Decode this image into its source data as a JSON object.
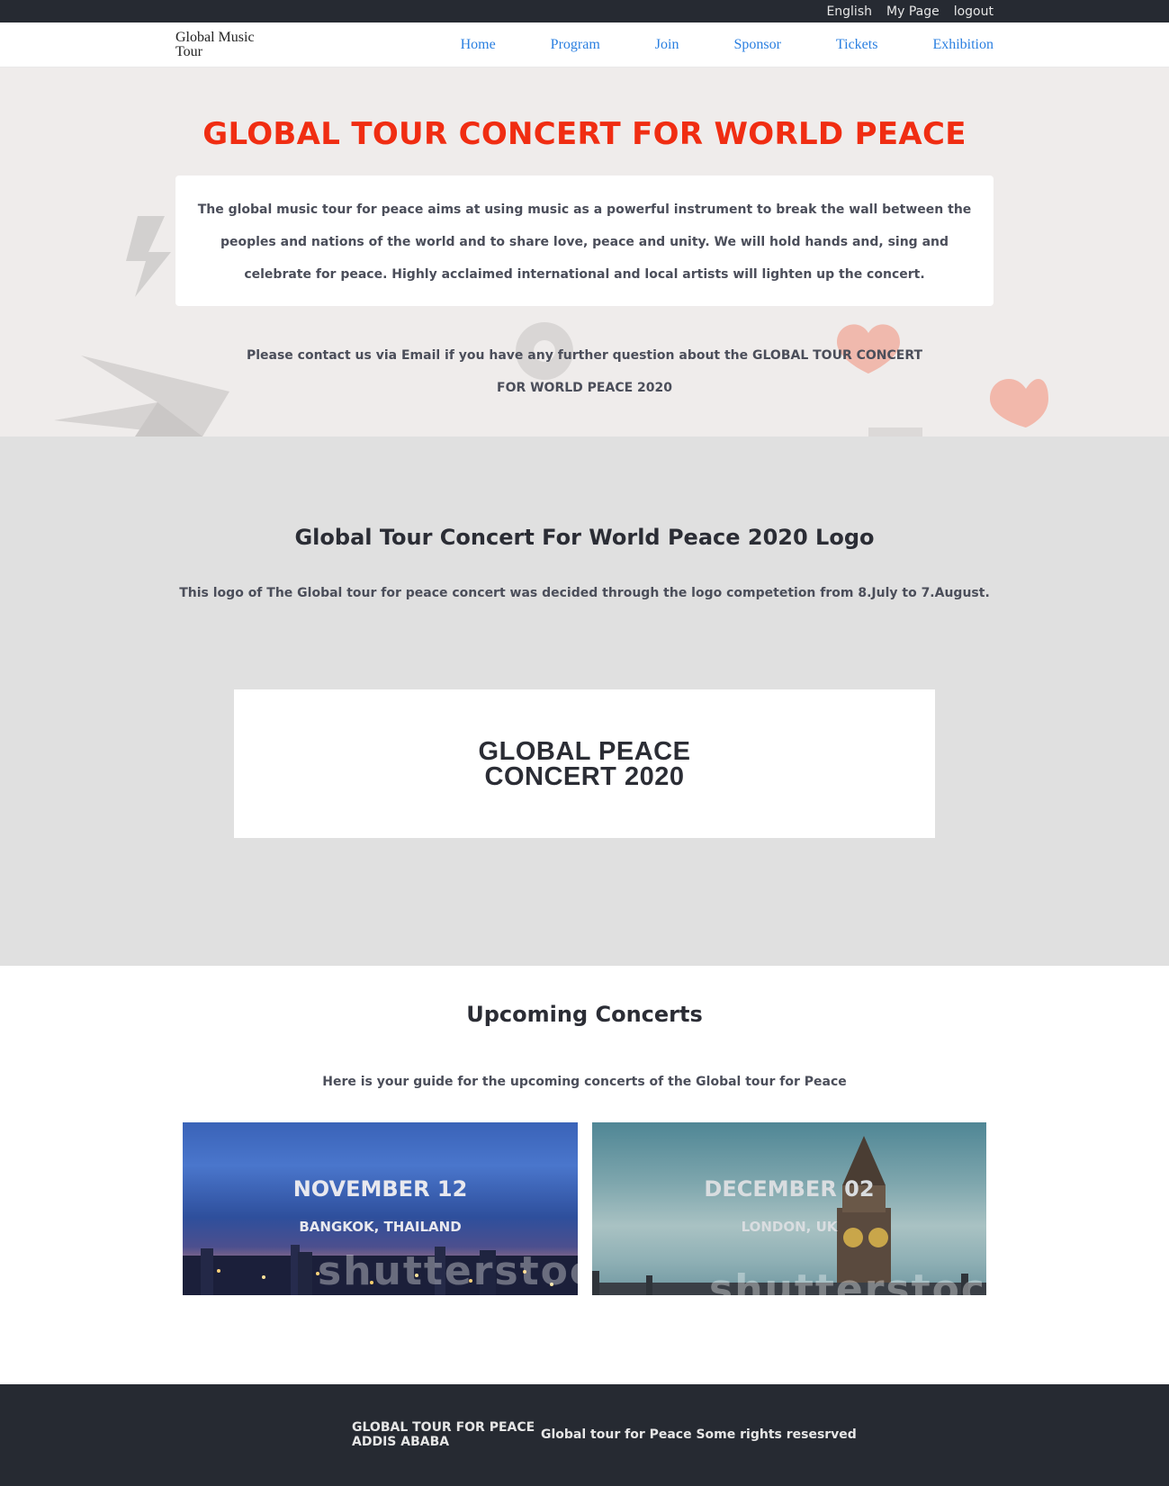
{
  "utility_bar": {
    "language": "English",
    "my_page": "My Page",
    "logout": "logout"
  },
  "navbar": {
    "brand_line1": "Global Music",
    "brand_line2": "Tour",
    "links": [
      "Home",
      "Program",
      "Join",
      "Sponsor",
      "Tickets",
      "Exhibition"
    ]
  },
  "hero": {
    "title": "GLOBAL TOUR CONCERT FOR WORLD PEACE",
    "intro": "The global music tour for peace aims at using music as a powerful instrument to break the wall between the peoples and nations of the world and to share love, peace and unity. We will hold hands and, sing and celebrate for peace. Highly acclaimed international and local artists will lighten up the concert.",
    "contact": "Please contact us via Email if you have any further question about the GLOBAL TOUR CONCERT FOR WORLD PEACE 2020"
  },
  "logo_section": {
    "heading": "Global Tour Concert For World Peace 2020 Logo",
    "description": "This logo of The Global tour for peace concert was decided through the logo competetion from 8.July to 7.August.",
    "logo_line1": "GLOBAL PEACE",
    "logo_line2": "CONCERT 2020"
  },
  "upcoming": {
    "heading": "Upcoming Concerts",
    "description": "Here is your guide for the upcoming concerts of the Global tour for Peace",
    "concerts": [
      {
        "date": "NOVEMBER 12",
        "city": "BANGKOK, THAILAND",
        "watermark": "shutterstock"
      },
      {
        "date": "DECEMBER 02",
        "city": "LONDON, UK",
        "watermark": "shutterstock"
      }
    ]
  },
  "footer": {
    "org_line1": "GLOBAL TOUR FOR PEACE",
    "org_line2": "ADDIS ABABA",
    "rights": "Global tour for Peace Some rights resesrved"
  },
  "colors": {
    "title_red": "#f02d12",
    "nav_link_blue": "#2a7fe0",
    "dark_bar": "#262a32",
    "hero_bg": "#efeceb",
    "logo_section_bg": "#e0e0e0"
  }
}
